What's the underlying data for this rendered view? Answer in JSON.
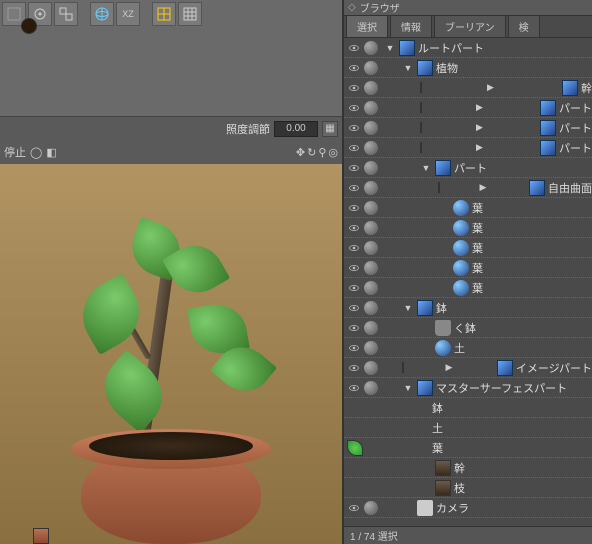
{
  "panel": {
    "title": "ブラウザ"
  },
  "tabs": [
    "選択",
    "情報",
    "ブーリアン",
    "検"
  ],
  "params": {
    "brightness_label": "照度調節",
    "brightness_value": "0.00",
    "stop_label": "停止"
  },
  "tree": [
    {
      "depth": 0,
      "arrow": "down",
      "icon": "part",
      "label": "ルートパート",
      "vis": true,
      "ball": true
    },
    {
      "depth": 1,
      "arrow": "down",
      "icon": "part",
      "label": "植物",
      "vis": true,
      "ball": true
    },
    {
      "depth": 2,
      "arrow": "right",
      "icon": "part",
      "label": "幹",
      "vis": true,
      "ball": true
    },
    {
      "depth": 2,
      "arrow": "right",
      "icon": "part",
      "label": "パート",
      "vis": true,
      "ball": true
    },
    {
      "depth": 2,
      "arrow": "right",
      "icon": "part",
      "label": "パート",
      "vis": true,
      "ball": true
    },
    {
      "depth": 2,
      "arrow": "right",
      "icon": "part",
      "label": "パート",
      "vis": true,
      "ball": true
    },
    {
      "depth": 2,
      "arrow": "down",
      "icon": "part",
      "label": "パート",
      "vis": true,
      "ball": true
    },
    {
      "depth": 3,
      "arrow": "right",
      "icon": "part",
      "label": "自由曲面",
      "vis": true,
      "ball": true
    },
    {
      "depth": 3,
      "arrow": "",
      "icon": "sphere",
      "label": "葉",
      "vis": true,
      "ball": true
    },
    {
      "depth": 3,
      "arrow": "",
      "icon": "sphere",
      "label": "葉",
      "vis": true,
      "ball": true
    },
    {
      "depth": 3,
      "arrow": "",
      "icon": "sphere",
      "label": "葉",
      "vis": true,
      "ball": true
    },
    {
      "depth": 3,
      "arrow": "",
      "icon": "sphere",
      "label": "葉",
      "vis": true,
      "ball": true
    },
    {
      "depth": 3,
      "arrow": "",
      "icon": "sphere",
      "label": "葉",
      "vis": true,
      "ball": true
    },
    {
      "depth": 1,
      "arrow": "down",
      "icon": "part",
      "label": "鉢",
      "vis": true,
      "ball": true
    },
    {
      "depth": 2,
      "arrow": "",
      "icon": "bucket",
      "label": "く鉢",
      "vis": true,
      "ball": true
    },
    {
      "depth": 2,
      "arrow": "",
      "icon": "sphere",
      "label": "土",
      "vis": true,
      "ball": true
    },
    {
      "depth": 1,
      "arrow": "right",
      "icon": "part",
      "label": "イメージパート",
      "vis": true,
      "ball": true
    },
    {
      "depth": 1,
      "arrow": "down",
      "icon": "part",
      "label": "マスターサーフェスパート",
      "vis": true,
      "ball": true
    },
    {
      "depth": 2,
      "arrow": "",
      "icon": "thumb pot",
      "label": "鉢",
      "vis": false,
      "ball": false
    },
    {
      "depth": 2,
      "arrow": "",
      "icon": "thumb soil",
      "label": "土",
      "vis": false,
      "ball": false
    },
    {
      "depth": 2,
      "arrow": "",
      "icon": "thumb leaf",
      "label": "葉",
      "vis": false,
      "ball": false
    },
    {
      "depth": 2,
      "arrow": "",
      "icon": "thumb bark",
      "label": "幹",
      "vis": false,
      "ball": false
    },
    {
      "depth": 2,
      "arrow": "",
      "icon": "thumb bark",
      "label": "枝",
      "vis": false,
      "ball": false
    },
    {
      "depth": 1,
      "arrow": "",
      "icon": "camera",
      "label": "カメラ",
      "vis": true,
      "ball": true
    }
  ],
  "status": "1 / 74 選択",
  "toolbar_icons": [
    "target-icon",
    "globe-icon",
    "xz-icon",
    "grid-yellow-icon",
    "grid-icon"
  ]
}
